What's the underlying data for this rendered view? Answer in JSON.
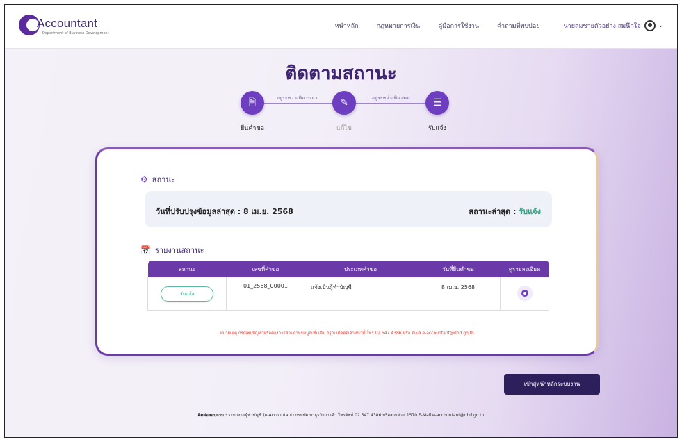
{
  "header": {
    "logo_text": "Accountant",
    "logo_sub": "Department of Business Development",
    "nav": [
      "หน้าหลัก",
      "กฎหมายการเงิน",
      "คู่มือการใช้งาน",
      "คำถามที่พบบ่อย"
    ],
    "user_name": "นายสมชายตัวอย่าง สมนึกใจ"
  },
  "page": {
    "title": "ติดตามสถานะ"
  },
  "stepper": {
    "steps": [
      {
        "label": "ยื่นคำขอ",
        "icon": "document-icon"
      },
      {
        "label": "แก้ไข",
        "icon": "edit-icon"
      },
      {
        "label": "รับแจ้ง",
        "icon": "checklist-icon"
      }
    ],
    "connectors": [
      "อยู่ระหว่างพิจารณา",
      "อยู่ระหว่างพิจารณา"
    ]
  },
  "status_section": {
    "heading": "สถานะ",
    "updated_label": "วันที่ปรับปรุงข้อมูลล่าสุด : 8 เม.ย. 2568",
    "latest_label": "สถานะล่าสุด :",
    "latest_value": "รับแจ้ง"
  },
  "report_section": {
    "heading": "รายงานสถานะ",
    "columns": [
      "สถานะ",
      "เลขที่คำขอ",
      "ประเภทคำขอ",
      "วันที่ยื่นคำขอ",
      "ดูรายละเอียด"
    ],
    "rows": [
      {
        "status": "รับแจ้ง",
        "request_no": "01_2568_00001",
        "type": "แจ้งเป็นผู้ทำบัญชี",
        "date": "8 เม.ย. 2568"
      }
    ],
    "note": "หมายเหตุ กรณีพบปัญหาหรือต้องการสอบถามข้อมูลเพิ่มเติม กรุณาติดต่อเจ้าหน้าที่ โทร 02 547 4386 หรือ อีเมล e-accountant@dbd.go.th"
  },
  "actions": {
    "back_label": "เข้าสู่หน้าหลักระบบงาน"
  },
  "footer": {
    "label": "ติดต่อสอบถาม :",
    "text": "ระบบงานผู้ทำบัญชี (e-Accountant) กรมพัฒนาธุรกิจการค้า โทรศัพท์ 02 547 4386 หรือสายด่วน 1570 E-Mail e-accountant@dbd.go.th"
  },
  "colors": {
    "primary": "#6b3aa8",
    "dark": "#2c1f5c",
    "success": "#2aa37f"
  }
}
